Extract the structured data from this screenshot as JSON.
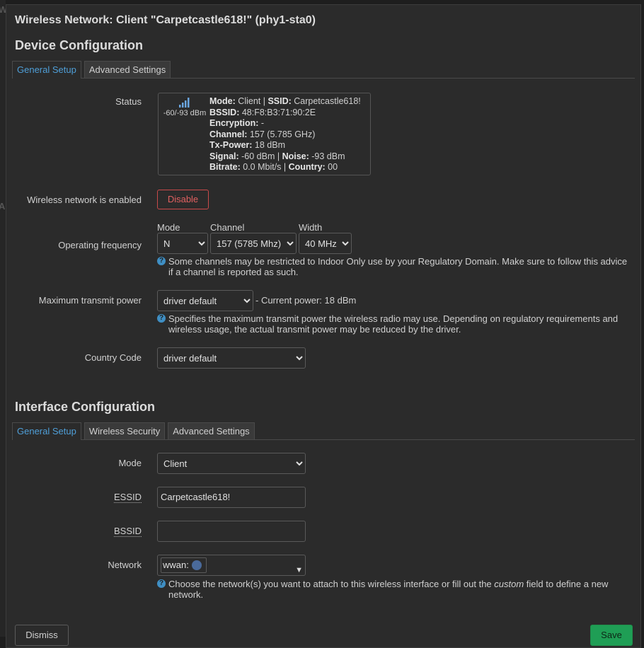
{
  "modal_title": "Wireless Network: Client \"Carpetcastle618!\" (phy1-sta0)",
  "device_config": {
    "heading": "Device Configuration",
    "tabs": [
      "General Setup",
      "Advanced Settings"
    ],
    "status_label": "Status",
    "status": {
      "signal_text": "-60/-93 dBm",
      "mode_label": "Mode:",
      "mode_value": " Client | ",
      "ssid_label": "SSID:",
      "ssid_value": " Carpetcastle618!",
      "bssid_label": "BSSID:",
      "bssid_value": " 48:F8:B3:71:90:2E",
      "encryption_label": "Encryption:",
      "encryption_value": " -",
      "channel_label": "Channel:",
      "channel_value": " 157 (5.785 GHz)",
      "txpower_label": "Tx-Power:",
      "txpower_value": " 18 dBm",
      "signal_label": "Signal:",
      "signal_value": " -60 dBm | ",
      "noise_label": "Noise:",
      "noise_value": " -93 dBm",
      "bitrate_label": "Bitrate:",
      "bitrate_value": " 0.0 Mbit/s | ",
      "country_label": "Country:",
      "country_value": " 00"
    },
    "enabled_label": "Wireless network is enabled",
    "disable_button": "Disable",
    "freq_label": "Operating frequency",
    "freq_mode_label": "Mode",
    "freq_channel_label": "Channel",
    "freq_width_label": "Width",
    "freq_mode_value": "N",
    "freq_channel_value": "157 (5785 Mhz)",
    "freq_width_value": "40 MHz",
    "freq_help": "Some channels may be restricted to Indoor Only use by your Regulatory Domain. Make sure to follow this advice if a channel is reported as such.",
    "txpower_label": "Maximum transmit power",
    "txpower_value": "driver default",
    "txpower_current": "- Current power: 18 dBm",
    "txpower_help": "Specifies the maximum transmit power the wireless radio may use. Depending on regulatory requirements and wireless usage, the actual transmit power may be reduced by the driver.",
    "country_label": "Country Code",
    "country_value": "driver default"
  },
  "interface_config": {
    "heading": "Interface Configuration",
    "tabs": [
      "General Setup",
      "Wireless Security",
      "Advanced Settings"
    ],
    "mode_label": "Mode",
    "mode_value": "Client",
    "essid_label": "ESSID",
    "essid_value": "Carpetcastle618!",
    "bssid_label": "BSSID",
    "bssid_value": "",
    "network_label": "Network",
    "network_chip": "wwan:",
    "network_help_pre": "Choose the network(s) you want to attach to this wireless interface or fill out the ",
    "network_help_em": "custom",
    "network_help_post": " field to define a new network."
  },
  "footer": {
    "dismiss": "Dismiss",
    "save": "Save"
  },
  "colors": {
    "accent": "#4f9fd8",
    "danger": "#e06060",
    "save": "#1f9e55"
  }
}
